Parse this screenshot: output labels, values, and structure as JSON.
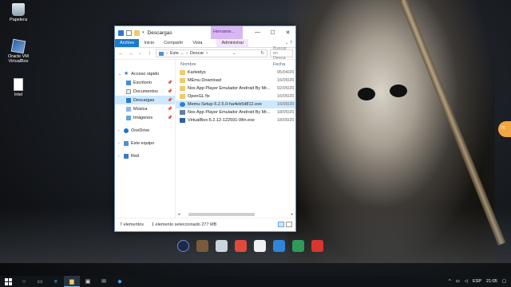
{
  "desktop": {
    "icons": [
      {
        "label": "Papelera"
      },
      {
        "label": "Oracle VM VirtualBox"
      },
      {
        "label": "Intel"
      }
    ]
  },
  "window": {
    "title": "Descargas",
    "tools_tab": "Herramie...",
    "ribbon_tabs": [
      "Archivo",
      "Inicio",
      "Compartir",
      "Vista",
      "Administrar"
    ],
    "address": {
      "parts": [
        "Este ...",
        "Descar"
      ]
    },
    "search_placeholder": "Buscar en Desca",
    "nav": {
      "quick_access": "Acceso rápido",
      "escritorio": "Escritorio",
      "documentos": "Documentos",
      "descargas": "Descargas",
      "musica": "Música",
      "imagenes": "Imágenes",
      "onedrive": "OneDrive",
      "este_equipo": "Este equipo",
      "red": "Red"
    },
    "columns": {
      "name": "Nombre",
      "date": "Fecha"
    },
    "files": [
      {
        "name": "Karleidys",
        "date": "05/04/20",
        "type": "folder"
      },
      {
        "name": "MEmu Download",
        "date": "16/05/20",
        "type": "folder"
      },
      {
        "name": "Nox App Player Emulador Android By Mr...",
        "date": "02/05/20",
        "type": "folder"
      },
      {
        "name": "OpenGL fix",
        "date": "16/05/20",
        "type": "folder"
      },
      {
        "name": "Memu-Setup-5.2.5.0-ha4eb5d812.exe",
        "date": "16/05/20",
        "type": "memu"
      },
      {
        "name": "Nox App Player Emulador Android By Mr...",
        "date": "18/05/20",
        "type": "nox"
      },
      {
        "name": "VirtualBox-5.2.12-122591-Win.exe",
        "date": "18/05/20",
        "type": "vbox"
      }
    ],
    "status": {
      "count": "7 elementos",
      "selected": "1 elemento seleccionado  277 MB"
    }
  },
  "badge": {
    "text": "75"
  },
  "taskbar": {
    "lang": "ESP",
    "time": "21:05"
  }
}
